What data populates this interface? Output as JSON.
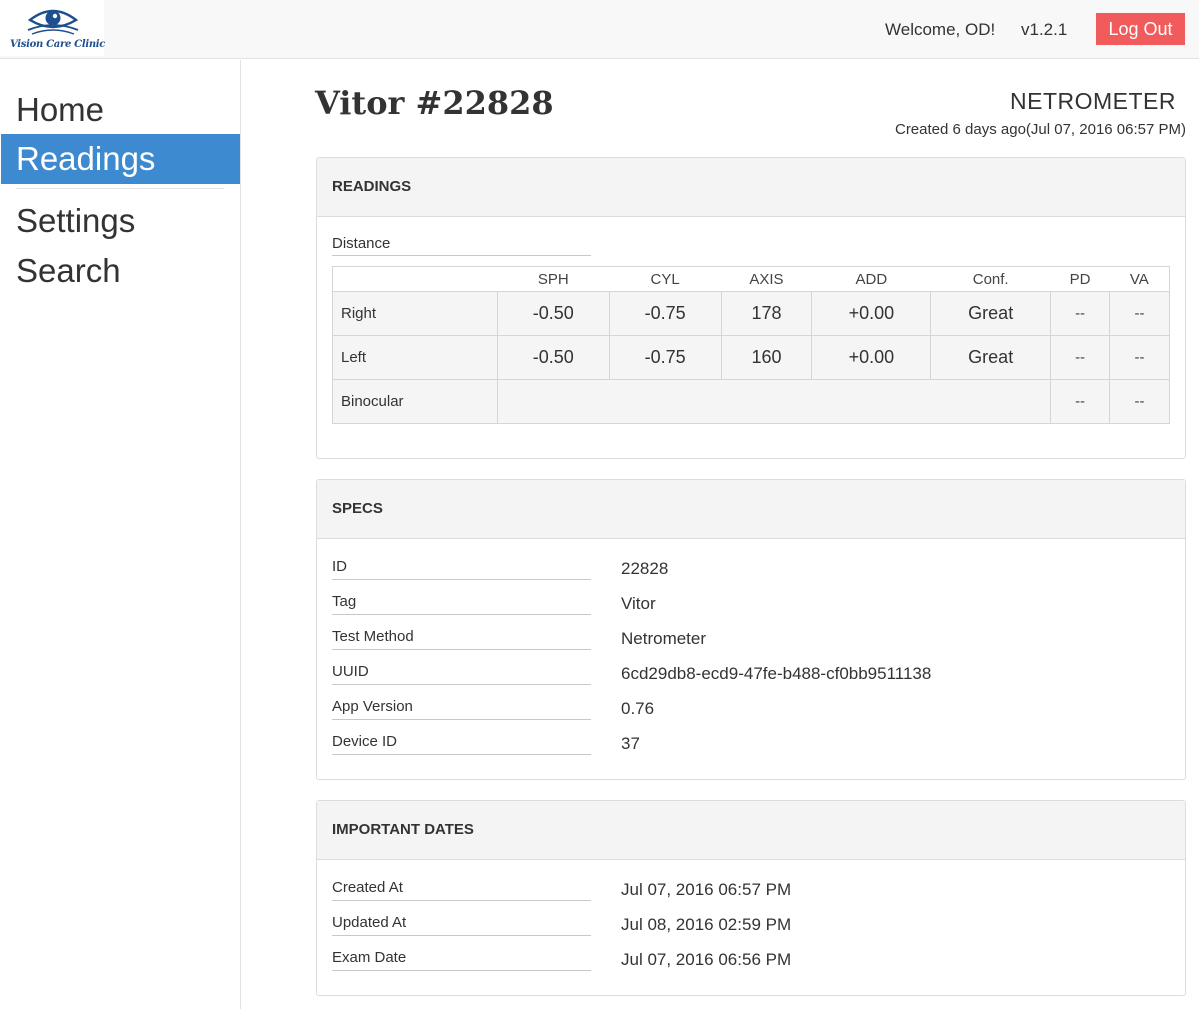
{
  "header": {
    "logo_text": "Vision Care Clinic",
    "welcome": "Welcome, OD!",
    "version": "v1.2.1",
    "logout_label": "Log Out"
  },
  "sidebar": {
    "items": [
      {
        "label": "Home",
        "active": false
      },
      {
        "label": "Readings",
        "active": true
      },
      {
        "label": "Settings",
        "active": false
      },
      {
        "label": "Search",
        "active": false
      }
    ]
  },
  "page": {
    "title": "Vitor #22828",
    "method": "NETROMETER",
    "created_line": "Created 6 days ago(Jul 07, 2016 06:57 PM)"
  },
  "readings": {
    "heading": "READINGS",
    "distance_label": "Distance",
    "columns": [
      "SPH",
      "CYL",
      "AXIS",
      "ADD",
      "Conf.",
      "PD",
      "VA"
    ],
    "rows": [
      {
        "label": "Right",
        "sph": "-0.50",
        "cyl": "-0.75",
        "axis": "178",
        "add": "+0.00",
        "conf": "Great",
        "pd": "--",
        "va": "--"
      },
      {
        "label": "Left",
        "sph": "-0.50",
        "cyl": "-0.75",
        "axis": "160",
        "add": "+0.00",
        "conf": "Great",
        "pd": "--",
        "va": "--"
      },
      {
        "label": "Binocular",
        "pd": "--",
        "va": "--"
      }
    ]
  },
  "specs": {
    "heading": "SPECS",
    "items": [
      {
        "label": "ID",
        "value": "22828"
      },
      {
        "label": "Tag",
        "value": "Vitor"
      },
      {
        "label": "Test Method",
        "value": "Netrometer"
      },
      {
        "label": "UUID",
        "value": "6cd29db8-ecd9-47fe-b488-cf0bb9511138"
      },
      {
        "label": "App Version",
        "value": "0.76"
      },
      {
        "label": "Device ID",
        "value": "37"
      }
    ]
  },
  "dates": {
    "heading": "IMPORTANT DATES",
    "items": [
      {
        "label": "Created At",
        "value": "Jul 07, 2016 06:57 PM"
      },
      {
        "label": "Updated At",
        "value": "Jul 08, 2016 02:59 PM"
      },
      {
        "label": "Exam Date",
        "value": "Jul 07, 2016 06:56 PM"
      }
    ]
  },
  "colors": {
    "active_nav": "#3d8ad1",
    "logout": "#f25b5b",
    "logo": "#1d4e8f"
  }
}
